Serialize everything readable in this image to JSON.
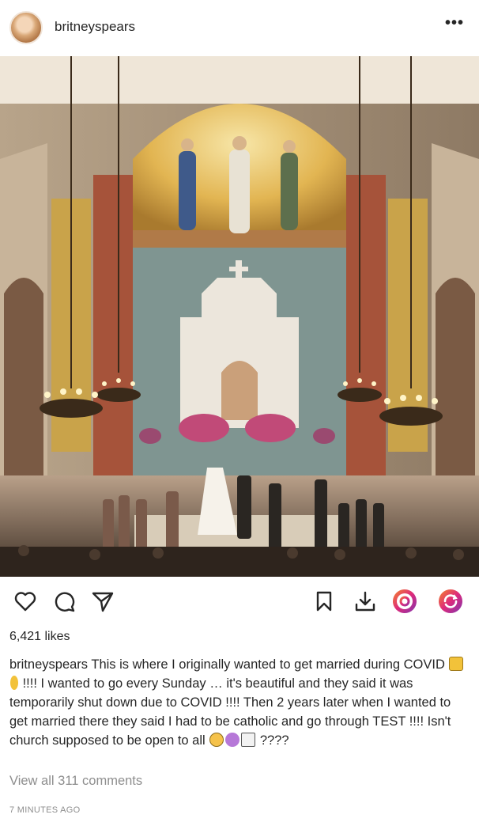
{
  "post": {
    "username": "britneyspears",
    "more_icon": "more-horizontal-icon",
    "more_glyph": "•••",
    "likes": "6,421 likes",
    "caption_user": "britneyspears",
    "caption_part1": "This is where I originally wanted to get married during COVID",
    "caption_part2": "!!!! I wanted to go every Sunday … it's beautiful and they said it was temporarily shut down due to COVID !!!! Then 2 years later when I wanted to get married there they said I had to be catholic and go through TEST !!!! Isn't church supposed to be open to all",
    "caption_part3": "????",
    "view_comments": "View all 311 comments",
    "timestamp": "7 MINUTES AGO"
  },
  "actions": {
    "left": [
      "heart-icon",
      "comment-icon",
      "share-icon"
    ],
    "right": [
      "bookmark-icon",
      "download-icon",
      "rec-icon",
      "repost-icon"
    ]
  },
  "colors": {
    "text": "#262626",
    "muted": "#8e8e8e",
    "accent_gradient": [
      "#f58529",
      "#dd2a7b",
      "#8134af"
    ]
  }
}
